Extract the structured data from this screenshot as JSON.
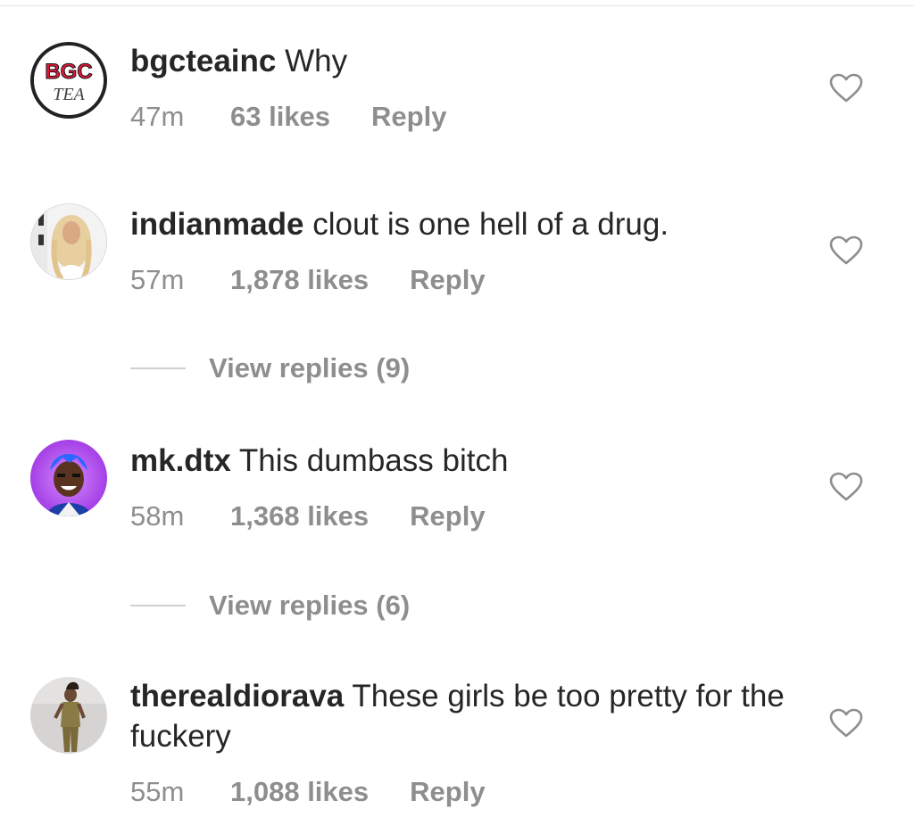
{
  "comments": [
    {
      "username": "bgcteainc",
      "text": "Why",
      "time": "47m",
      "likes": "63 likes",
      "reply": "Reply",
      "avatar_text_top": "BGC",
      "avatar_text_bottom": "TEA"
    },
    {
      "username": "indianmade",
      "text": "clout is one hell of a drug.",
      "time": "57m",
      "likes": "1,878 likes",
      "reply": "Reply",
      "view_replies": "View replies (9)"
    },
    {
      "username": "mk.dtx",
      "text": "This dumbass bitch",
      "time": "58m",
      "likes": "1,368 likes",
      "reply": "Reply",
      "view_replies": "View replies (6)"
    },
    {
      "username": "therealdiorava",
      "text": "These girls be too pretty for the fuckery",
      "time": "55m",
      "likes": "1,088 likes",
      "reply": "Reply"
    }
  ],
  "icons": {
    "like": "heart-outline-icon"
  },
  "colors": {
    "text": "#262626",
    "meta": "#8e8e8e",
    "bgc_red": "#e8193c",
    "avatar_purple": "#a13ee6"
  }
}
